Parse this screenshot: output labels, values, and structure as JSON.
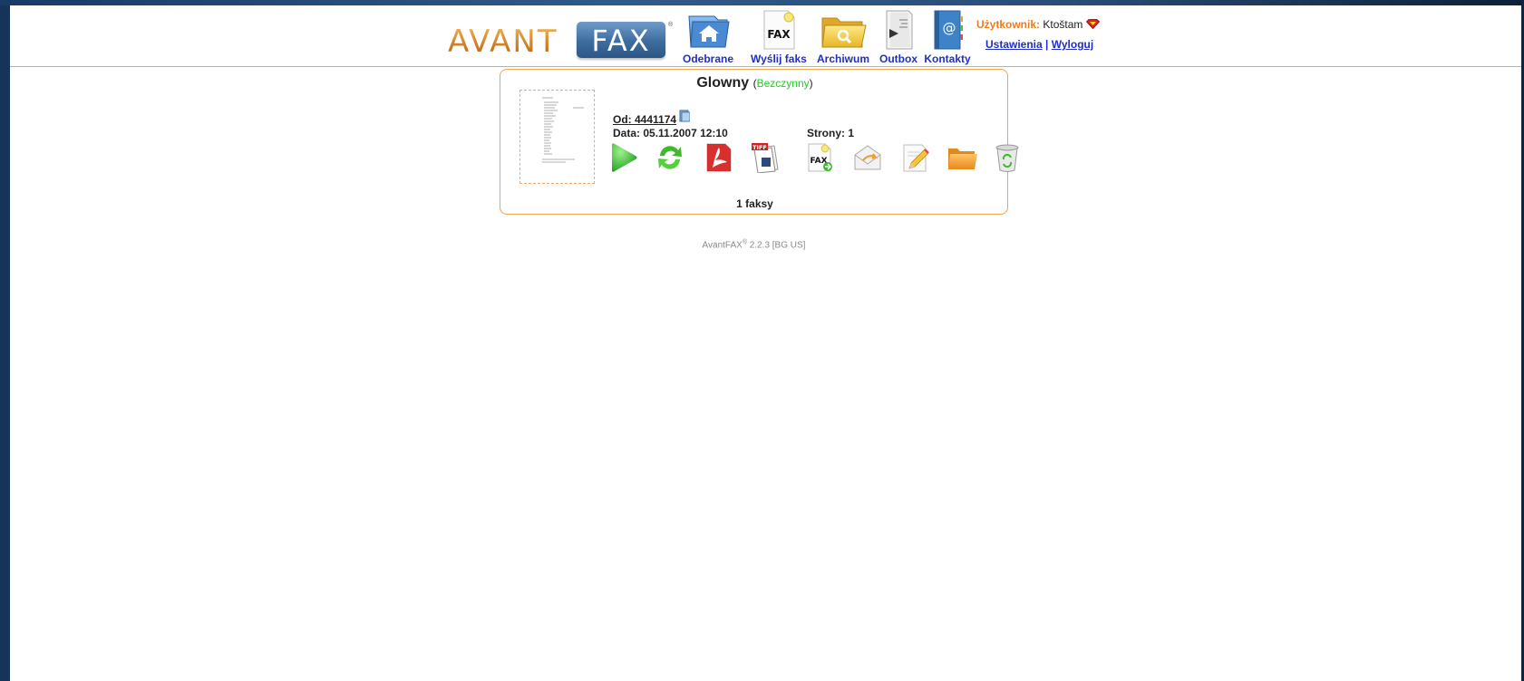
{
  "brand": {
    "name_part1": "AVANT",
    "name_part2": "FAX",
    "registered": "®"
  },
  "nav": [
    {
      "label": "Odebrane",
      "icon": "inbox-home-icon"
    },
    {
      "label": "Wyślij faks",
      "icon": "send-fax-icon"
    },
    {
      "label": "Archiwum",
      "icon": "archive-folder-icon"
    },
    {
      "label": "Outbox",
      "icon": "outbox-icon"
    },
    {
      "label": "Kontakty",
      "icon": "contacts-book-icon"
    }
  ],
  "user": {
    "label": "Użytkownik:",
    "name": "Ktoštam",
    "settings_link": "Ustawienia",
    "separator": "|",
    "logout_link": "Wyloguj"
  },
  "panel": {
    "title": "Glowny",
    "status_open": "(",
    "status": "Bezczynny",
    "status_close": ")",
    "status_color": "#22cc22",
    "fax": {
      "from_label": "Od: 4441174",
      "date_label": "Data: 05.11.2007 12:10",
      "pages_label": "Strony: 1",
      "actions": [
        "play-icon",
        "refresh-icon",
        "pdf-icon",
        "tiff-icon",
        "resend-fax-icon",
        "email-icon",
        "edit-note-icon",
        "archive-folder-icon",
        "trash-icon"
      ]
    },
    "count": "1 faksy"
  },
  "footer": {
    "app": "AvantFAX",
    "registered": "®",
    "version": " 2.2.3 [BG US]"
  },
  "colors": {
    "accent_orange": "#f1a34b",
    "link_blue": "#1f2fc4",
    "user_label": "#ef7a1c"
  }
}
